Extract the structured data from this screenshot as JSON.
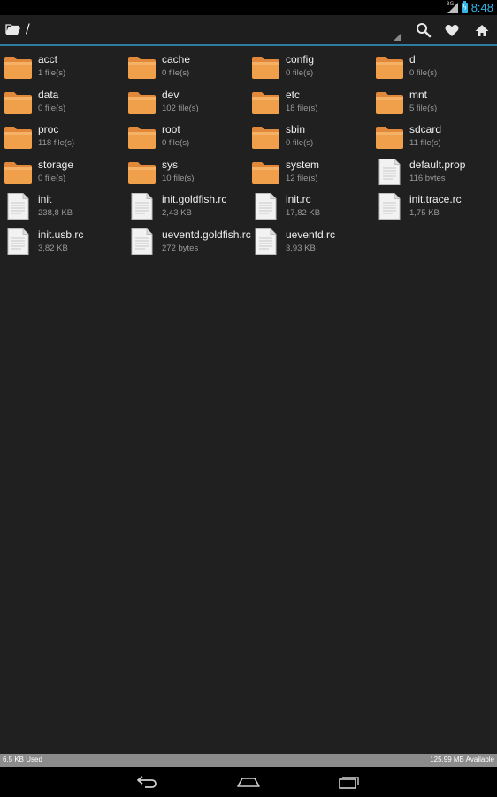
{
  "status_bar": {
    "time": "8:48",
    "network": "3G"
  },
  "action_bar": {
    "path": "/"
  },
  "files": [
    {
      "name": "acct",
      "meta": "1 file(s)",
      "type": "folder"
    },
    {
      "name": "cache",
      "meta": "0 file(s)",
      "type": "folder"
    },
    {
      "name": "config",
      "meta": "0 file(s)",
      "type": "folder"
    },
    {
      "name": "d",
      "meta": "0 file(s)",
      "type": "folder"
    },
    {
      "name": "data",
      "meta": "0 file(s)",
      "type": "folder"
    },
    {
      "name": "dev",
      "meta": "102 file(s)",
      "type": "folder"
    },
    {
      "name": "etc",
      "meta": "18 file(s)",
      "type": "folder"
    },
    {
      "name": "mnt",
      "meta": "5 file(s)",
      "type": "folder"
    },
    {
      "name": "proc",
      "meta": "118 file(s)",
      "type": "folder"
    },
    {
      "name": "root",
      "meta": "0 file(s)",
      "type": "folder"
    },
    {
      "name": "sbin",
      "meta": "0 file(s)",
      "type": "folder"
    },
    {
      "name": "sdcard",
      "meta": "11 file(s)",
      "type": "folder"
    },
    {
      "name": "storage",
      "meta": "0 file(s)",
      "type": "folder"
    },
    {
      "name": "sys",
      "meta": "10 file(s)",
      "type": "folder"
    },
    {
      "name": "system",
      "meta": "12 file(s)",
      "type": "folder"
    },
    {
      "name": "default.prop",
      "meta": "116 bytes",
      "type": "file"
    },
    {
      "name": "init",
      "meta": "238,8 KB",
      "type": "file"
    },
    {
      "name": "init.goldfish.rc",
      "meta": "2,43 KB",
      "type": "file"
    },
    {
      "name": "init.rc",
      "meta": "17,82 KB",
      "type": "file"
    },
    {
      "name": "init.trace.rc",
      "meta": "1,75 KB",
      "type": "file"
    },
    {
      "name": "init.usb.rc",
      "meta": "3,82 KB",
      "type": "file"
    },
    {
      "name": "ueventd.goldfish.rc",
      "meta": "272 bytes",
      "type": "file"
    },
    {
      "name": "ueventd.rc",
      "meta": "3,93 KB",
      "type": "file"
    }
  ],
  "footer": {
    "used": "6,5 KB Used",
    "available": "125,99 MB Available"
  },
  "icons": {
    "folder": "folder-icon",
    "file": "document-icon",
    "search": "search-icon",
    "favorite": "heart-icon",
    "home": "home-icon",
    "back": "back-icon",
    "nav_home": "nav-home-icon",
    "recents": "recent-apps-icon"
  },
  "colors": {
    "accent": "#33b5e5",
    "folder": "#f0a04b",
    "background": "#202020",
    "action_bar": "#1e1e1e",
    "divider": "#2c7c9e"
  }
}
